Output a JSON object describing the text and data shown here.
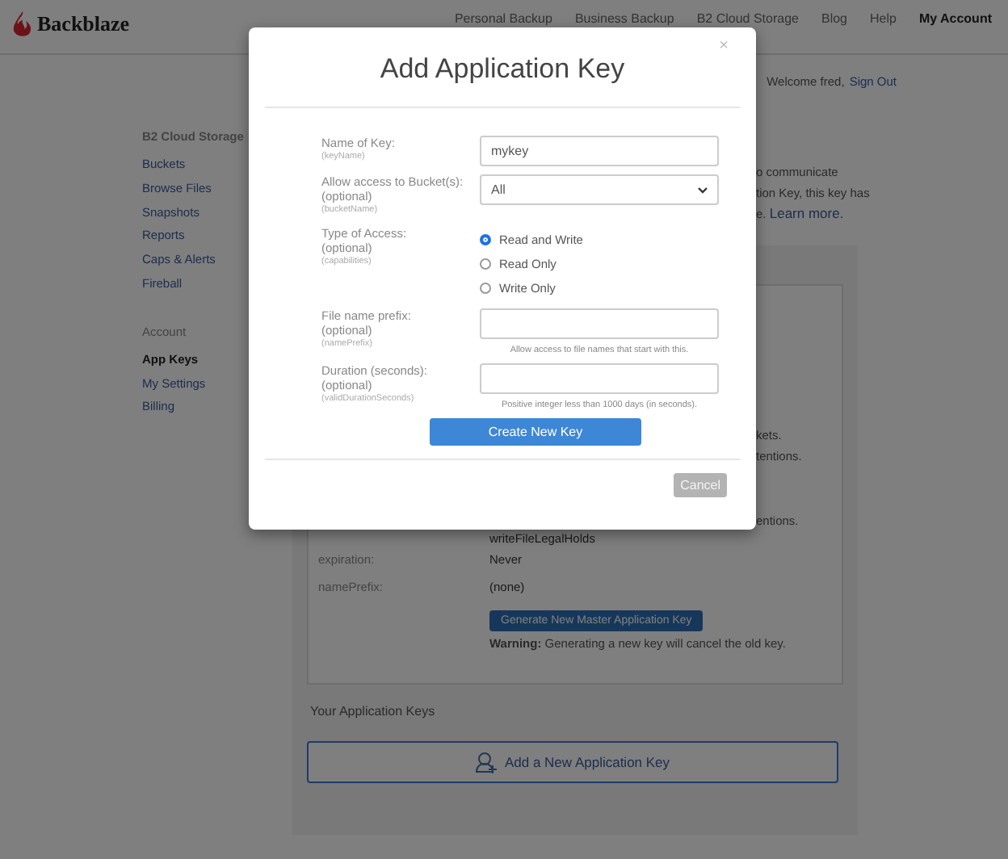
{
  "header": {
    "logo": "Backblaze",
    "nav": [
      {
        "label": "Personal Backup",
        "selected": false
      },
      {
        "label": "Business Backup",
        "selected": false
      },
      {
        "label": "B2 Cloud Storage",
        "selected": false
      },
      {
        "label": "Blog",
        "selected": false
      },
      {
        "label": "Help",
        "selected": false
      },
      {
        "label": "My Account",
        "selected": true
      }
    ]
  },
  "user": {
    "greeting": "Welcome fred,",
    "link": "Sign Out"
  },
  "sidebar": [
    {
      "heading": "B2 Cloud Storage",
      "items": [
        {
          "label": "Buckets",
          "selected": false
        },
        {
          "label": "Browse Files",
          "selected": false
        },
        {
          "label": "Snapshots",
          "selected": false
        },
        {
          "label": "Reports",
          "selected": false
        },
        {
          "label": "Caps & Alerts",
          "selected": false
        },
        {
          "label": "Fireball",
          "selected": false
        }
      ]
    },
    {
      "heading": "Account",
      "items": [
        {
          "label": "App Keys",
          "selected": true
        },
        {
          "label": "My Settings",
          "selected": false
        },
        {
          "label": "Billing",
          "selected": false
        }
      ]
    }
  ],
  "intro": [
    {
      "text": "o communicate"
    },
    {
      "text": "tion Key, this key has"
    },
    {
      "text": "e.",
      "link": "Learn more."
    }
  ],
  "master_key": {
    "fragments": [
      "kets.",
      "tentions."
    ],
    "fragment_after": "entions.",
    "capability": "writeFileLegalHolds",
    "fields": [
      {
        "label": "expiration:",
        "value": "Never"
      },
      {
        "label": "namePrefix:",
        "value": "(none)"
      }
    ],
    "button": "Generate New Master Application Key",
    "warning": "**Warning:** Generating a new key will cancel the old key."
  },
  "keys_section": {
    "title": "Your Application Keys",
    "add_button": "Add a New Application Key"
  },
  "dialog": {
    "title": "Add Application Key",
    "close": "×",
    "fields": [
      {
        "kind": "text",
        "label": "Name of Key:",
        "hint": "(keyName)",
        "value": "mykey"
      },
      {
        "kind": "select",
        "label": "Allow access to Bucket(s):",
        "optional": "(optional)",
        "hint": "(bucketName)",
        "value": "All"
      },
      {
        "kind": "radio",
        "label": "Type of Access:",
        "optional": "(optional)",
        "hint": "(capabilities)",
        "options": [
          {
            "label": "Read and Write",
            "selected": true
          },
          {
            "label": "Read Only",
            "selected": false
          },
          {
            "label": "Write Only",
            "selected": false
          }
        ]
      },
      {
        "kind": "text",
        "label": "File name prefix:",
        "optional": "(optional)",
        "hint": "(namePrefix)",
        "help": "Allow access to file names that start with this."
      },
      {
        "kind": "text",
        "label": "Duration (seconds):",
        "optional": "(optional)",
        "hint": "(validDurationSeconds)",
        "help": "Positive integer less than 1000 days (in seconds)."
      }
    ],
    "submit": "Create New Key",
    "cancel": {
      "label": "Cancel",
      "disabled": true
    }
  }
}
